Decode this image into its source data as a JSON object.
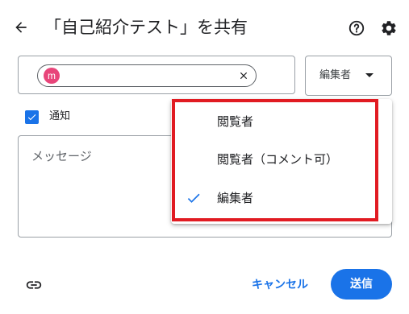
{
  "header": {
    "title": "「自己紹介テスト」を共有",
    "back_icon": "arrow-back-icon",
    "help_icon": "help-circle-icon",
    "settings_icon": "gear-icon"
  },
  "people": {
    "chip": {
      "avatar_letter": "m",
      "avatar_color": "#e8457a",
      "name": "",
      "remove_icon": "close-icon"
    }
  },
  "role_button": {
    "label": "編集者",
    "caret_icon": "caret-down-icon"
  },
  "notify": {
    "checked": true,
    "label": "通知"
  },
  "message": {
    "placeholder": "メッセージ"
  },
  "footer": {
    "link_icon": "link-icon",
    "cancel_label": "キャンセル",
    "send_label": "送信"
  },
  "role_menu": {
    "items": [
      {
        "label": "閲覧者",
        "selected": false
      },
      {
        "label": "閲覧者（コメント可）",
        "selected": false
      },
      {
        "label": "編集者",
        "selected": true
      }
    ],
    "check_icon": "check-icon"
  },
  "colors": {
    "accent": "#1a73e8",
    "highlight": "#e11b22",
    "text": "#202124"
  }
}
